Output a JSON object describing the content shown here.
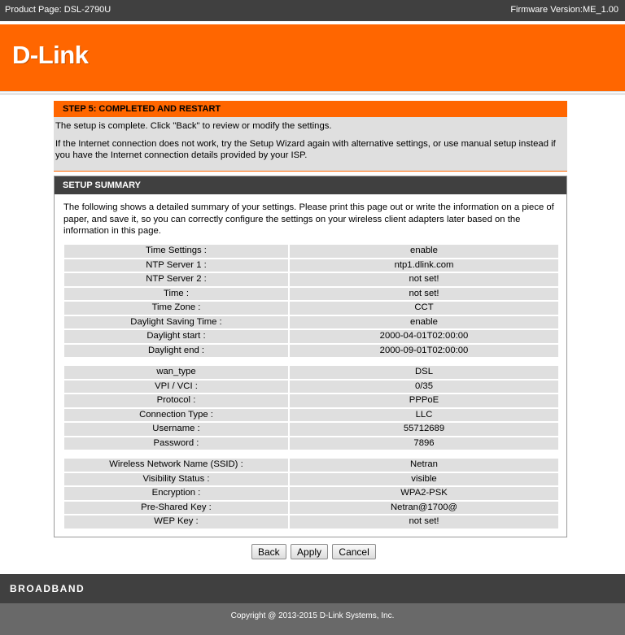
{
  "topbar": {
    "product_page": "Product Page: DSL-2790U",
    "firmware": "Firmware Version:ME_1.00"
  },
  "header": {
    "logo_text": "D-Link"
  },
  "step": {
    "title": "STEP 5: COMPLETED AND RESTART",
    "line1": "The setup is complete. Click \"Back\" to review or modify the settings.",
    "line2": "If the Internet connection does not work, try the Setup Wizard again with alternative settings, or use manual setup instead if you have the Internet connection details provided by your ISP."
  },
  "summary": {
    "title": "SETUP SUMMARY",
    "description": "The following shows a detailed summary of your settings. Please print this page out or write the information on a piece of paper, and save it, so you can correctly configure the settings on your wireless client adapters later based on the information in this page.",
    "time_rows": [
      {
        "label": "Time Settings :",
        "value": "enable"
      },
      {
        "label": "NTP Server 1 :",
        "value": "ntp1.dlink.com"
      },
      {
        "label": "NTP Server 2 :",
        "value": "not set!"
      },
      {
        "label": "Time :",
        "value": "not set!"
      },
      {
        "label": "Time Zone :",
        "value": "CCT"
      },
      {
        "label": "Daylight Saving Time :",
        "value": "enable"
      },
      {
        "label": "Daylight start :",
        "value": "2000-04-01T02:00:00"
      },
      {
        "label": "Daylight end :",
        "value": "2000-09-01T02:00:00"
      }
    ],
    "wan_rows": [
      {
        "label": "wan_type",
        "value": "DSL"
      },
      {
        "label": "VPI / VCI :",
        "value": "0/35"
      },
      {
        "label": "Protocol :",
        "value": "PPPoE"
      },
      {
        "label": "Connection Type :",
        "value": "LLC"
      },
      {
        "label": "Username :",
        "value": "55712689"
      },
      {
        "label": "Password :",
        "value": "7896"
      }
    ],
    "wireless_rows": [
      {
        "label": "Wireless Network Name (SSID) :",
        "value": "Netran"
      },
      {
        "label": "Visibility Status :",
        "value": "visible"
      },
      {
        "label": "Encryption :",
        "value": "WPA2-PSK"
      },
      {
        "label": "Pre-Shared Key :",
        "value": "Netran@1700@"
      },
      {
        "label": "WEP Key :",
        "value": "not set!"
      }
    ]
  },
  "buttons": {
    "back": "Back",
    "apply": "Apply",
    "cancel": "Cancel"
  },
  "footer": {
    "brand": "BROADBAND",
    "copyright": "Copyright @ 2013-2015 D-Link Systems, Inc."
  },
  "colors": {
    "accent_orange": "#ff6600",
    "dark_gray": "#404040",
    "cell_gray": "#dfdfdf"
  }
}
